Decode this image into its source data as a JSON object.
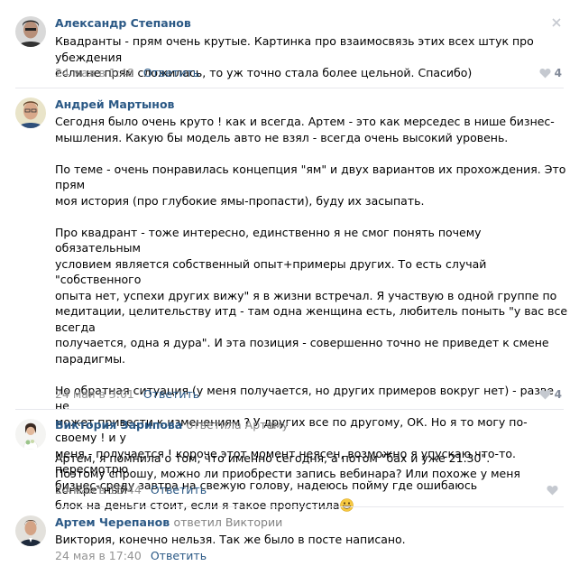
{
  "comments": [
    {
      "author": "Александр Степанов",
      "text": "Квадранты - прям очень крутые. Картинка про взаимосвязь этих всех штук про убеждения\nесли не прям сложилась, то уж точно стала более цельной. Спасибо)",
      "date": "24 мая в 1:48",
      "reply_label": "Ответить",
      "likes": "4"
    },
    {
      "author": "Андрей Мартынов",
      "text": "Сегодня было очень круто ! как и всегда. Артем - это как мерседес в нише бизнес-\nмышления. Какую бы модель авто не взял - всегда очень высокий уровень.\n\nПо теме - очень понравилась концепция \"ям\" и двух вариантов их прохождения. Это прям\nмоя история (про глубокие ямы-пропасти), буду их засыпать.\n\nПро квадрант - тоже интересно, единственно я не смог понять почему обязательным\nусловием является собственный опыт+примеры других. То есть случай \"собственного\nопыта нет, успехи других вижу\" я в жизни встречал. Я участвую в одной группе по\nмедитации, целительству итд - там одна женщина есть, любитель поныть \"у вас все всегда\nполучается, одна я дура\". И эта позиция - совершенно точно не приведет к смене\nпарадигмы.\n\nНо обратная ситуация (у меня получается, но других примеров вокруг нет) - разве не\nможет привести к изменениям ? У других все по другому, ОК. Но я то могу по-своему ! и у\nменя - получается ! короче этот момент неясен, возможно я упускаю что-то. пересмотрю\nбизнес-среду завтра на свежую голову, надеюсь пойму где ошибаюсь",
      "date": "24 мая в 3:01",
      "reply_label": "Ответить",
      "likes": "4"
    },
    {
      "author": "Виктория Зарипова",
      "replied_to_prefix": "ответила",
      "replied_to": "Артему",
      "text": "Артем, я помнила о том, что именно сегодня, а потом \"бах и уже 21.30\".\nПоэтому спрошу, можно ли приобрести запись вебинара? Или похоже у меня конкретный\nблок на деньги стоит, если я такое пропустила",
      "date": "24 мая в 16:44",
      "reply_label": "Ответить",
      "likes": ""
    },
    {
      "author": "Артем Черепанов",
      "replied_to_prefix": "ответил",
      "replied_to": "Виктории",
      "text": "Виктория, конечно нельзя. Так же было в посте написано.",
      "date": "24 мая в 17:40",
      "reply_label": "Ответить",
      "likes": ""
    }
  ],
  "colors": {
    "link": "#2a5885",
    "meta": "#939393",
    "like_icon": "#c5c9d0",
    "divider": "#e7e8ec"
  },
  "icons": {
    "like": "heart-icon",
    "close": "close-icon",
    "emoji": "grinning-face-icon"
  }
}
